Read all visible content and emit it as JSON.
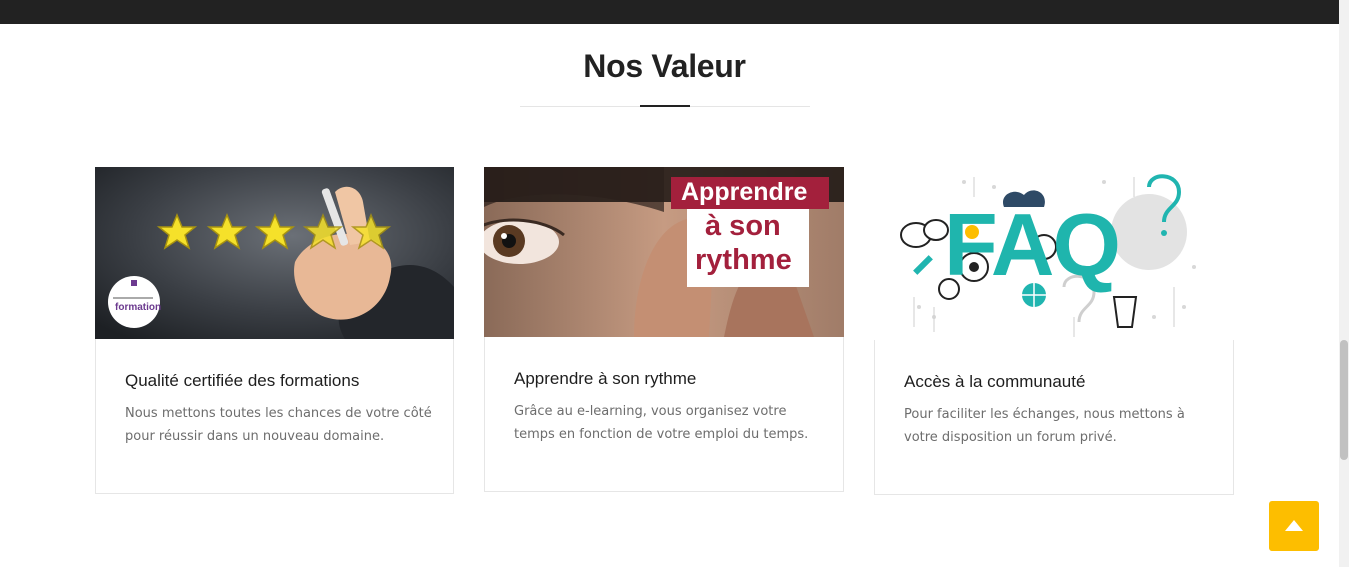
{
  "section": {
    "title": "Nos Valeur"
  },
  "cards": [
    {
      "title": "Qualité certifiée des formations",
      "text": "Nous mettons toutes les chances de votre côté pour réussir dans un nouveau domaine.",
      "image": {
        "icon": "stars-rating-image",
        "logo_text": "formation"
      }
    },
    {
      "title": "Apprendre à son rythme",
      "text": "Grâce au e-learning, vous organisez votre temps en fonction de votre emploi du temps.",
      "image": {
        "icon": "eye-learning-image",
        "banner_line1": "Apprendre",
        "banner_line2": "à son",
        "banner_line3": "rythme"
      }
    },
    {
      "title": "Accès à la communauté",
      "text": "Pour faciliter les échanges, nous mettons à votre disposition un forum privé.",
      "image": {
        "icon": "faq-image",
        "faq_text": "FAQ"
      }
    }
  ],
  "colors": {
    "topbar": "#222222",
    "accent": "#fdbe00",
    "banner_red": "#a3203c",
    "faq_teal": "#1fb5ad"
  },
  "scroll_top": {
    "icon": "arrow-up-icon"
  }
}
